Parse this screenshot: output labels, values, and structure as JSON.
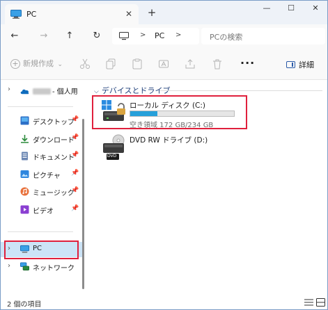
{
  "tab": {
    "title": "PC",
    "close_glyph": "✕",
    "new_tab_glyph": "+"
  },
  "window_controls": {
    "minimize": "—",
    "maximize": "☐",
    "close": "✕"
  },
  "nav_buttons": {
    "back": "←",
    "forward": "→",
    "up": "↑",
    "refresh": "↻"
  },
  "address": {
    "separator": ">",
    "location": "PC"
  },
  "search": {
    "placeholder": "PCの検索"
  },
  "commandbar": {
    "new_label": "新規作成",
    "new_glyph": "+",
    "new_chevron": "⌄",
    "more_glyph": "···",
    "details_label": "詳細"
  },
  "sidebar": {
    "onedrive": {
      "label": "- 個人用"
    },
    "quick_access": [
      {
        "label": "デスクトップ",
        "icon": "desktop-icon",
        "pinned": true
      },
      {
        "label": "ダウンロード",
        "icon": "download-icon",
        "pinned": true
      },
      {
        "label": "ドキュメント",
        "icon": "documents-icon",
        "pinned": true
      },
      {
        "label": "ピクチャ",
        "icon": "pictures-icon",
        "pinned": true
      },
      {
        "label": "ミュージック",
        "icon": "music-icon",
        "pinned": true
      },
      {
        "label": "ビデオ",
        "icon": "videos-icon",
        "pinned": true
      }
    ],
    "pin_glyph": "📌",
    "chevron": "›",
    "pc": {
      "label": "PC",
      "selected": true
    },
    "network": {
      "label": "ネットワーク"
    }
  },
  "content": {
    "group_title": "デバイスとドライブ",
    "group_chevron": "⌵",
    "drives": [
      {
        "name": "ローカル ディスク (C:)",
        "free_text": "空き領域 172 GB/234 GB",
        "used_fraction": 0.265,
        "highlighted": true
      },
      {
        "name": "DVD RW ドライブ (D:)",
        "badge": "DVD"
      }
    ]
  },
  "status": {
    "item_count": "2 個の項目"
  },
  "colors": {
    "accent": "#26a0da",
    "highlight_box": "#e0203c",
    "selection": "#cce4f7",
    "group_header": "#1f3f7a"
  }
}
